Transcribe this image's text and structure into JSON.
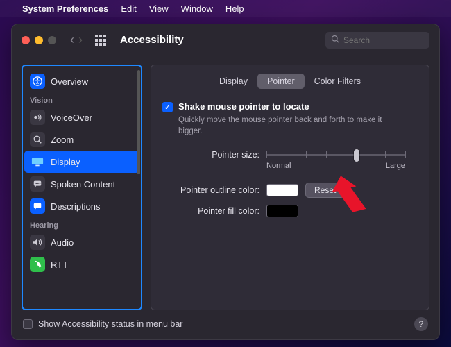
{
  "menubar": {
    "appname": "System Preferences",
    "items": [
      "Edit",
      "View",
      "Window",
      "Help"
    ]
  },
  "window": {
    "title": "Accessibility",
    "search_placeholder": "Search"
  },
  "sidebar": {
    "overview": "Overview",
    "groups": [
      {
        "header": "Vision",
        "items": [
          {
            "icon": "voiceover-icon",
            "label": "VoiceOver"
          },
          {
            "icon": "zoom-icon",
            "label": "Zoom"
          },
          {
            "icon": "display-icon",
            "label": "Display",
            "selected": true
          },
          {
            "icon": "spoken-content-icon",
            "label": "Spoken Content"
          },
          {
            "icon": "descriptions-icon",
            "label": "Descriptions"
          }
        ]
      },
      {
        "header": "Hearing",
        "items": [
          {
            "icon": "audio-icon",
            "label": "Audio"
          },
          {
            "icon": "rtt-icon",
            "label": "RTT"
          }
        ]
      }
    ]
  },
  "tabs": {
    "items": [
      "Display",
      "Pointer",
      "Color Filters"
    ],
    "active_index": 1
  },
  "pointer": {
    "shake_checked": true,
    "shake_label": "Shake mouse pointer to locate",
    "shake_hint": "Quickly move the mouse pointer back and forth to make it bigger.",
    "size_label": "Pointer size:",
    "size_min_label": "Normal",
    "size_max_label": "Large",
    "size_value": 0.65,
    "outline_label": "Pointer outline color:",
    "outline_color": "#ffffff",
    "fill_label": "Pointer fill color:",
    "fill_color": "#000000",
    "reset_label": "Reset"
  },
  "footer": {
    "status_checked": false,
    "status_label": "Show Accessibility status in menu bar"
  }
}
